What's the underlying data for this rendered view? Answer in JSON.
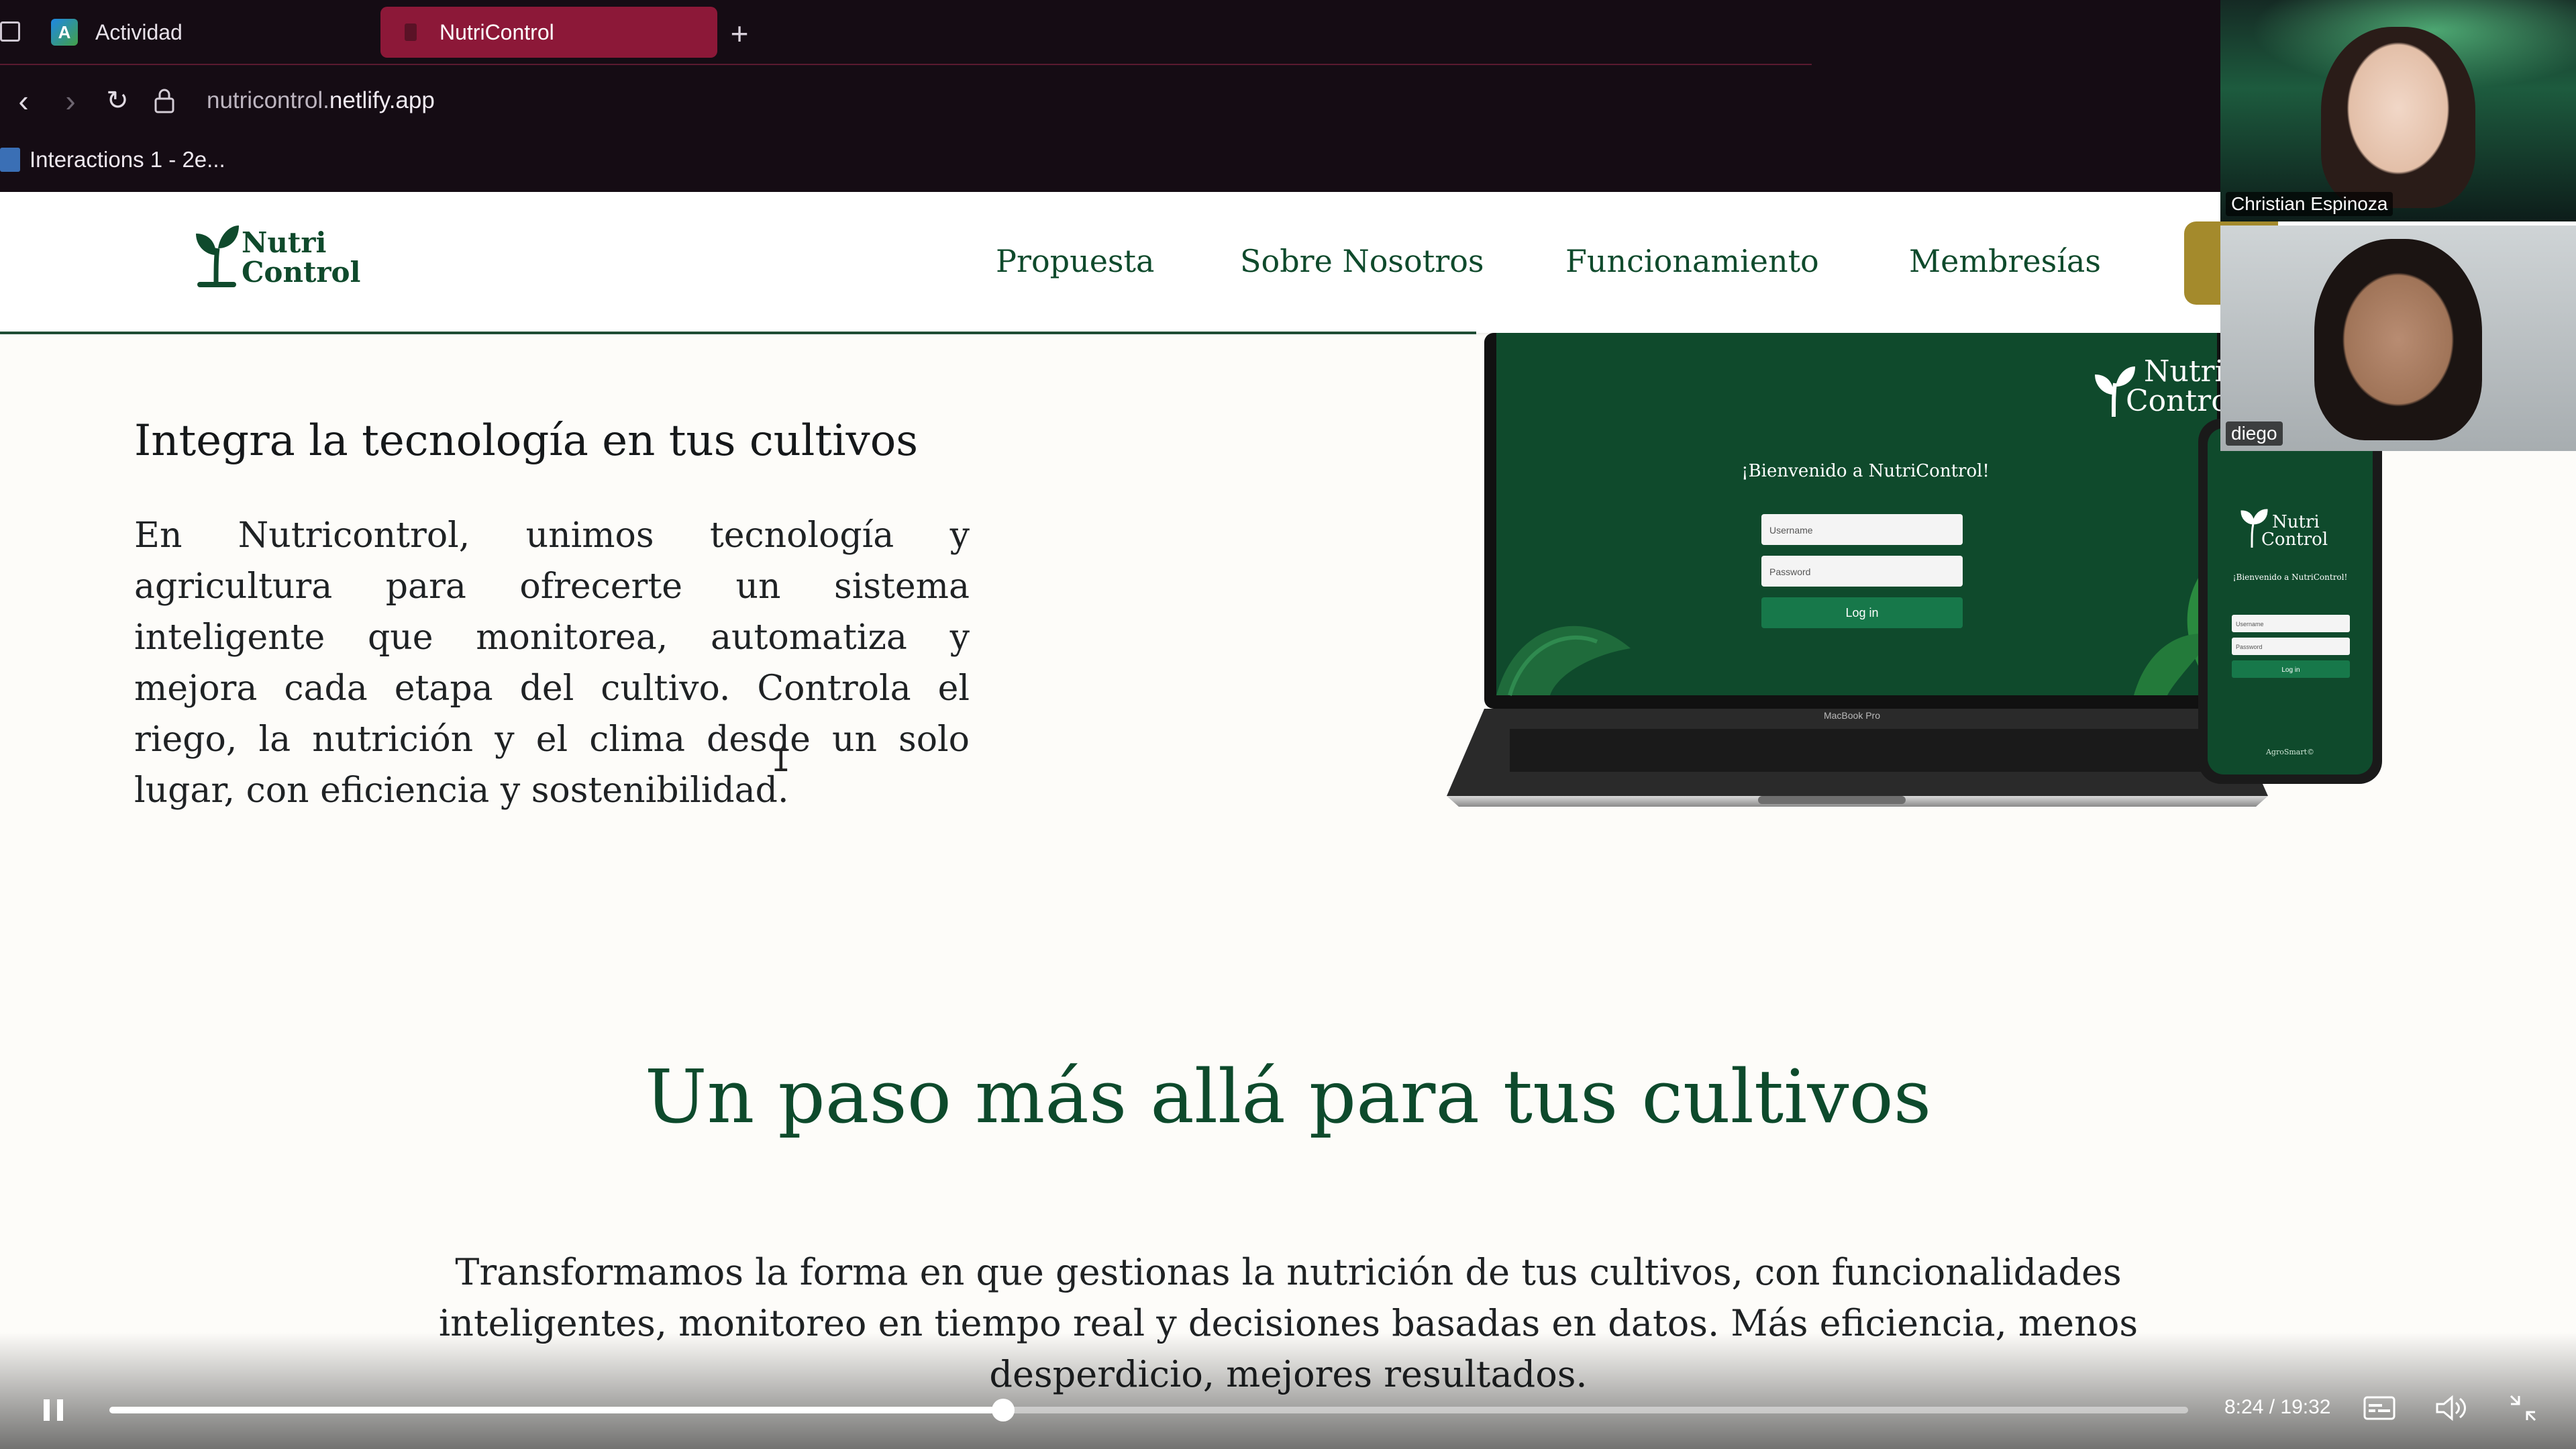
{
  "browser": {
    "tabs": [
      {
        "label": "Actividad",
        "icon": "app-icon"
      },
      {
        "label": "NutriControl",
        "icon": "site-icon"
      }
    ],
    "url_prefix": "nutricontrol.",
    "url_domain": "netlify.app",
    "bookmark": "Interactions 1 - 2e..."
  },
  "site": {
    "logo_line1": "Nutri",
    "logo_line2": "Control",
    "nav": [
      "Propuesta",
      "Sobre Nosotros",
      "Funcionamiento",
      "Membresías"
    ],
    "section_heading": "Integra la tecnología en tus cultivos",
    "section_text": "En Nutricontrol, unimos tecnología y agricultura para ofrecerte un sistema inteligente que monitorea, automatiza y mejora cada etapa del cultivo. Controla el riego, la nutrición y el clima desde un solo lugar, con eficiencia y sostenibilidad.",
    "mockup": {
      "logo_line1": "Nutri",
      "logo_line2": "Control",
      "welcome": "¡Bienvenido a NutriControl!",
      "username_placeholder": "Username",
      "password_placeholder": "Password",
      "login": "Log in",
      "laptop_label": "MacBook Pro",
      "phone_welcome": "¡Bienvenido a NutriControl!",
      "phone_username": "Username",
      "phone_password": "Password",
      "phone_login": "Log in",
      "phone_footer": "AgroSmart©"
    },
    "big_title": "Un paso más allá para tus cultivos",
    "lead": "Transformamos la forma en que gestionas la nutrición de tus cultivos, con funcionalidades inteligentes, monitoreo en tiempo real y decisiones basadas en datos. Más eficiencia, menos desperdicio, mejores resultados."
  },
  "participants": [
    {
      "name": "Christian Espinoza"
    },
    {
      "name": "diego"
    }
  ],
  "player": {
    "time": "8:24 / 19:32",
    "progress": 0.43
  },
  "colors": {
    "brand_green": "#0f4a2c",
    "accent_gold": "#a48a2c",
    "tab_active": "#8c1838"
  }
}
